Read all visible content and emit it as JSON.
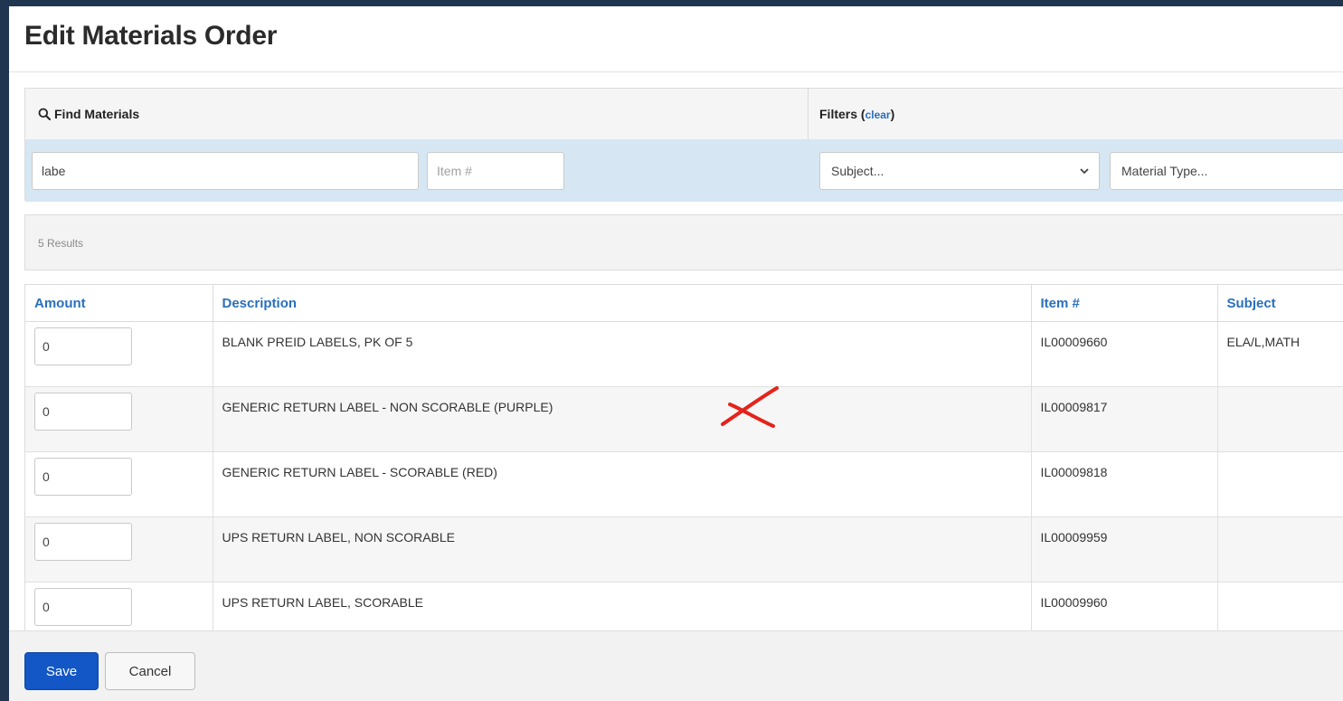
{
  "page": {
    "title": "Edit Materials Order"
  },
  "find": {
    "label": "Find Materials",
    "search_value": "labe",
    "item_placeholder": "Item #",
    "filters_label": "Filters (",
    "filters_clear": "clear",
    "filters_close": ")",
    "subject_select": "Subject...",
    "material_type_select": "Material Type..."
  },
  "results": {
    "count_text": "5 Results"
  },
  "table": {
    "headers": {
      "amount": "Amount",
      "description": "Description",
      "item": "Item #",
      "subject": "Subject"
    },
    "rows": [
      {
        "amount": "0",
        "description": "BLANK PREID LABELS, PK OF 5",
        "item": "IL00009660",
        "subject": "ELA/L,MATH"
      },
      {
        "amount": "0",
        "description": "GENERIC RETURN LABEL - NON SCORABLE (PURPLE)",
        "item": "IL00009817",
        "subject": ""
      },
      {
        "amount": "0",
        "description": "GENERIC RETURN LABEL - SCORABLE (RED)",
        "item": "IL00009818",
        "subject": ""
      },
      {
        "amount": "0",
        "description": "UPS RETURN LABEL, NON SCORABLE",
        "item": "IL00009959",
        "subject": ""
      },
      {
        "amount": "0",
        "description": "UPS RETURN LABEL, SCORABLE",
        "item": "IL00009960",
        "subject": ""
      }
    ]
  },
  "actions": {
    "save": "Save",
    "cancel": "Cancel"
  },
  "icons": {
    "search": "search-icon",
    "chevron": "chevron-down-icon",
    "annotation": "red-x-mark"
  },
  "colors": {
    "primary": "#1356c5",
    "link": "#2a6fbd",
    "filter_band": "#d6e7f3",
    "annotation": "#e5231b"
  }
}
